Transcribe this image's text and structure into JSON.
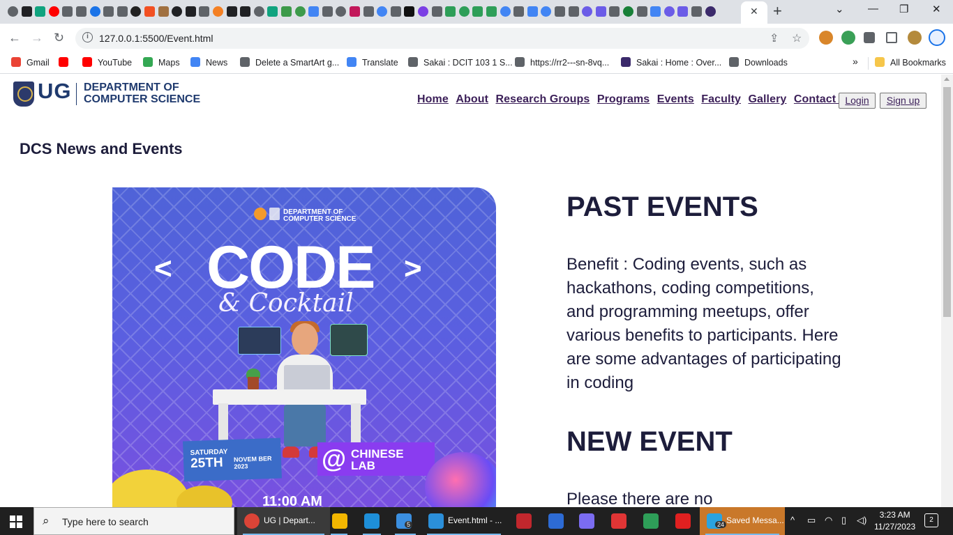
{
  "browser": {
    "tabs_close_glyph": "✕",
    "new_tab_glyph": "+",
    "window_controls": [
      "⌄",
      "—",
      "❐",
      "✕"
    ],
    "url": "127.0.0.1:5500/Event.html",
    "bookmarks": [
      {
        "label": "Gmail",
        "color": "#ea4335"
      },
      {
        "label": "",
        "color": "#ff0000"
      },
      {
        "label": "YouTube",
        "color": "#ff0000"
      },
      {
        "label": "Maps",
        "color": "#34a853"
      },
      {
        "label": "News",
        "color": "#4285f4"
      },
      {
        "label": "Delete a SmartArt g...",
        "color": "#5f6368"
      },
      {
        "label": "Translate",
        "color": "#4285f4"
      },
      {
        "label": "Sakai : DCIT 103 1 S...",
        "color": "#5f6368"
      },
      {
        "label": "https://rr2---sn-8vq...",
        "color": "#5f6368"
      },
      {
        "label": "Sakai : Home : Over...",
        "color": "#3b2a6b"
      },
      {
        "label": "Downloads",
        "color": "#5f6368"
      }
    ],
    "all_bookmarks": "All Bookmarks",
    "overflow": "»"
  },
  "site": {
    "logo_ug": "UG",
    "logo_dept": "DEPARTMENT OF COMPUTER SCIENCE",
    "nav": [
      "Home",
      "About",
      "Research Groups",
      "Programs",
      "Events",
      "Faculty",
      "Gallery",
      "Contact Us"
    ],
    "login": "Login",
    "signup": "Sign up",
    "section_title": "DCS News and Events",
    "poster": {
      "dept": "DEPARTMENT OF COMPUTER SCIENCE",
      "code": "CODE",
      "cocktail": "& Cocktail",
      "saturday": "SATURDAY",
      "day": "25TH",
      "month": "NOVEM BER 2023",
      "at": "@",
      "lab": "CHINESE LAB",
      "time": "11:00 AM"
    },
    "past_heading": "PAST EVENTS",
    "past_text": "Benefit : Coding events, such as hackathons, coding competitions, and programming meetups, offer various benefits to participants. Here are some advantages of participating in coding",
    "new_heading": "NEW EVENT",
    "new_text": "Please there are no"
  },
  "taskbar": {
    "search_placeholder": "Type here to search",
    "items": [
      {
        "label": "UG | Depart...",
        "color": "#db4437"
      },
      {
        "label": "",
        "color": "#f2b600"
      },
      {
        "label": "",
        "color": "#1e8fd8"
      },
      {
        "label": "",
        "color": "#3b8fe0",
        "badge": "5"
      },
      {
        "label": "Event.html - ...",
        "color": "#2b8fd9"
      },
      {
        "label": "",
        "color": "#c1272d"
      },
      {
        "label": "",
        "color": "#2d6bd4"
      },
      {
        "label": "",
        "color": "#7b6cf0"
      },
      {
        "label": "",
        "color": "#e03535"
      },
      {
        "label": "",
        "color": "#2e9e58"
      },
      {
        "label": "",
        "color": "#e02020"
      },
      {
        "label": "Saved Messa...",
        "color": "#2aa3e0",
        "badge": "24"
      }
    ],
    "time": "3:23 AM",
    "date": "11/27/2023",
    "notifications": "2"
  }
}
